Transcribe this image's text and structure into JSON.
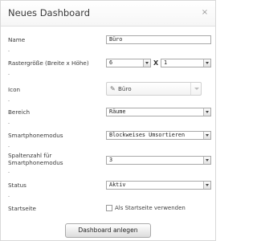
{
  "dialog": {
    "title": "Neues Dashboard",
    "close_symbol": "×",
    "close_icon": "close-icon"
  },
  "form": {
    "name": {
      "label": "Name",
      "value": "Büro"
    },
    "grid": {
      "label": "Rastergröße (Breite x Höhe)",
      "width_value": "6",
      "separator": "X",
      "height_value": "1"
    },
    "icon": {
      "label": "Icon",
      "value": "Büro",
      "icon_name": "pencil-icon",
      "icon_glyph": "✎"
    },
    "area": {
      "label": "Bereich",
      "value": "Räume"
    },
    "smartphone_mode": {
      "label": "Smartphonemodus",
      "value": "Blockweises Umsortieren"
    },
    "columns": {
      "label_line1": "Spaltenzahl für",
      "label_line2": "Smartphonemodus",
      "value": "3"
    },
    "status": {
      "label": "Status",
      "value": "Aktiv"
    },
    "startpage": {
      "label": "Startseite",
      "checkbox_label": "Als Startseite verwenden",
      "checked": false
    }
  },
  "actions": {
    "submit_label": "Dashboard anlegen"
  },
  "colors": {
    "border": "#d8d8d8",
    "text": "#333333",
    "field_border": "#a8a8a8"
  }
}
